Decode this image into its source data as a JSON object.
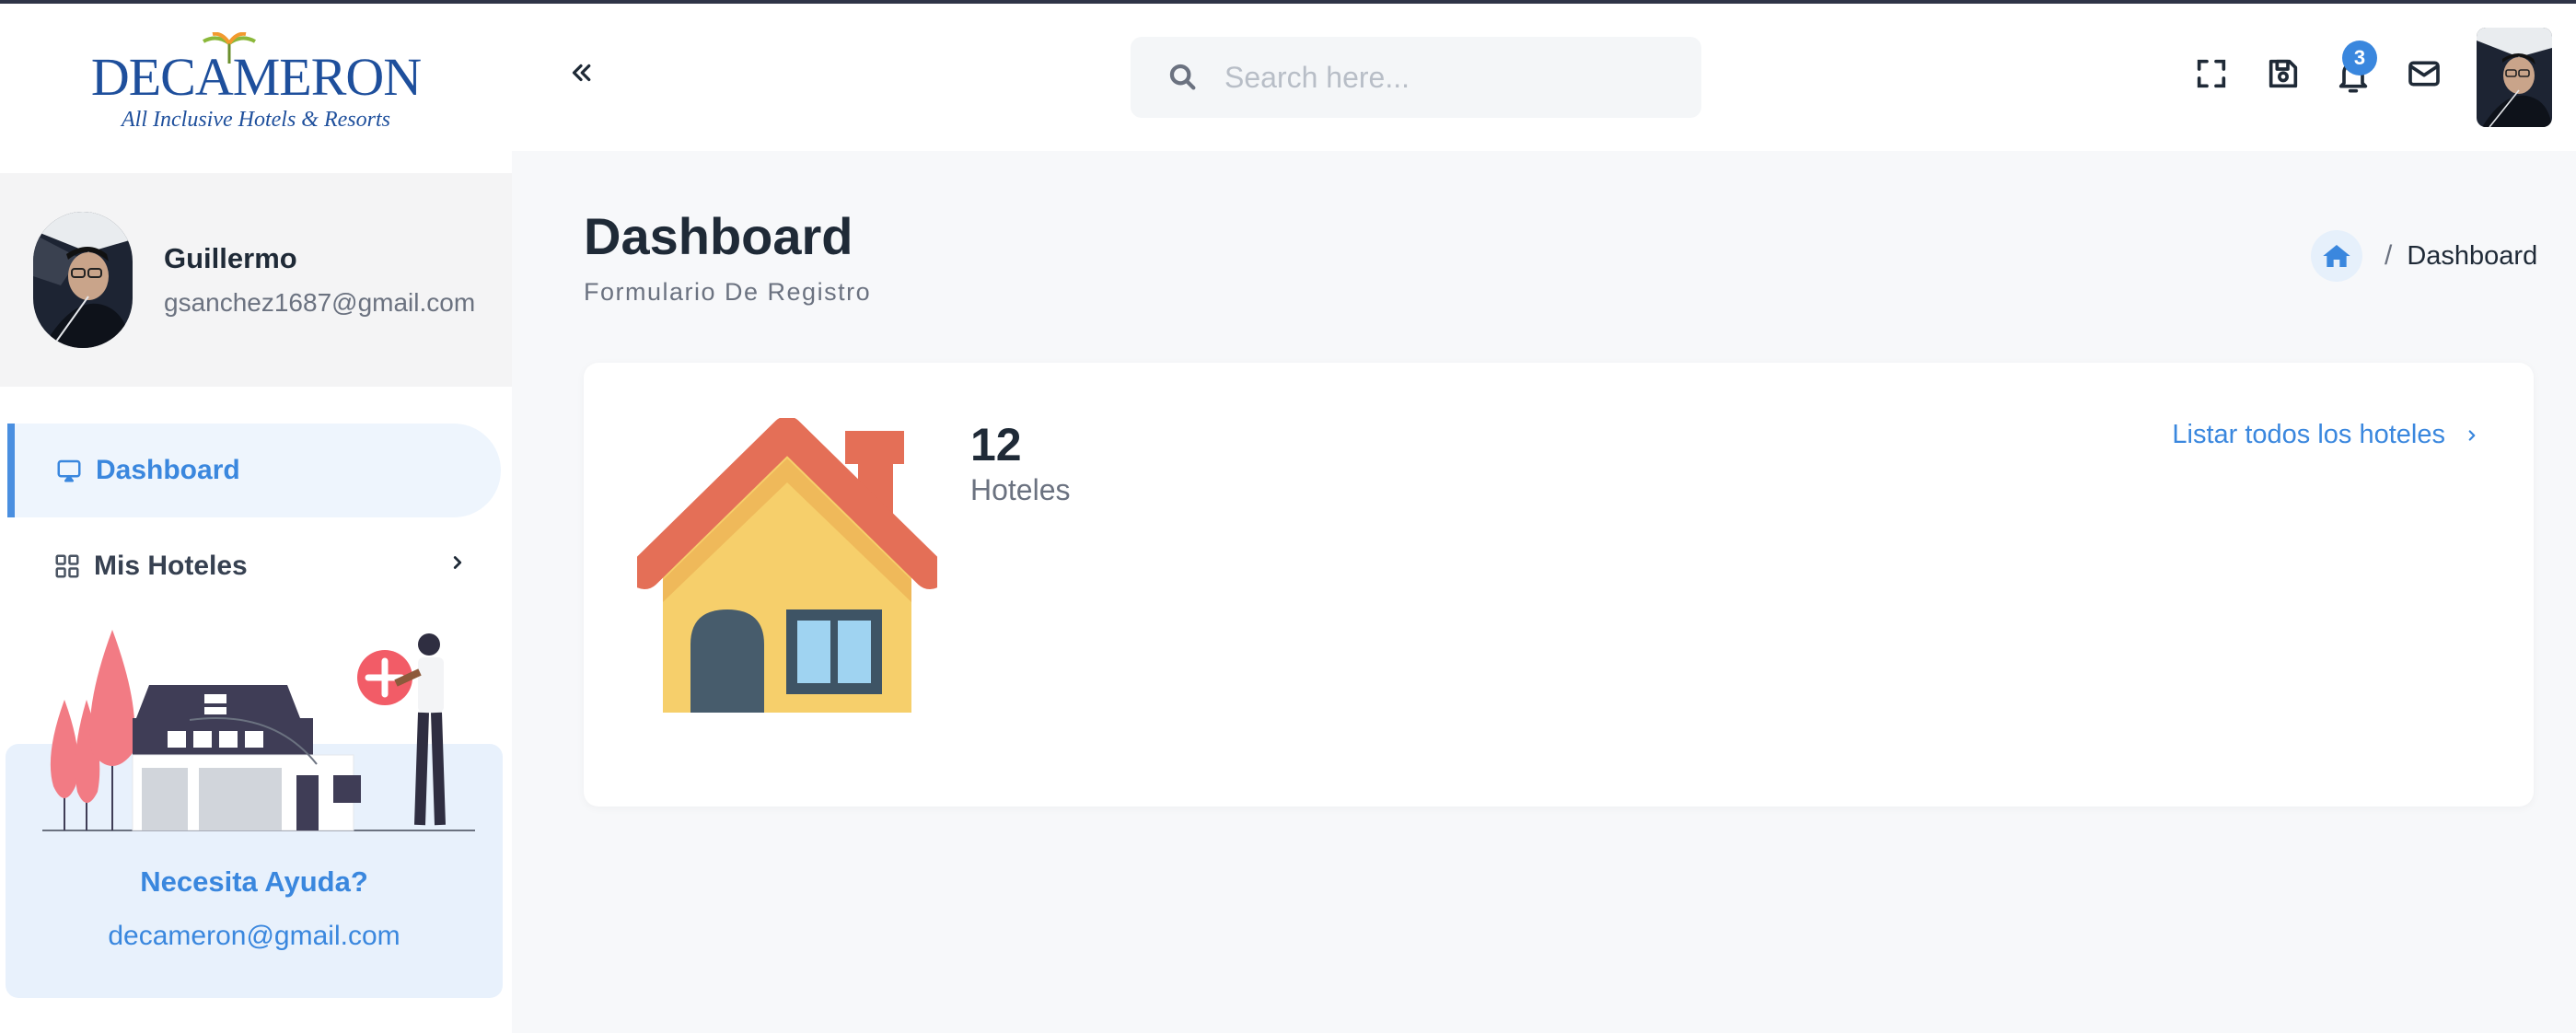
{
  "brand": {
    "logo_word": "DECAMERON",
    "logo_tagline": "All Inclusive Hotels & Resorts"
  },
  "user": {
    "name": "Guillermo",
    "email": "gsanchez1687@gmail.com"
  },
  "sidebar": {
    "items": [
      {
        "label": "Dashboard",
        "icon": "monitor-icon",
        "active": true
      },
      {
        "label": "Mis Hoteles",
        "icon": "grid-icon",
        "active": false,
        "has_submenu": true
      }
    ]
  },
  "help": {
    "title": "Necesita Ayuda?",
    "email": "decameron@gmail.com"
  },
  "header": {
    "search_placeholder": "Search here...",
    "notification_count": "3",
    "icons": [
      "collapse-icon",
      "search-icon",
      "fullscreen-icon",
      "save-icon",
      "bell-icon",
      "mail-icon"
    ]
  },
  "page": {
    "title": "Dashboard",
    "subtitle": "Formulario De Registro"
  },
  "breadcrumb": {
    "current": "Dashboard",
    "separator": "/"
  },
  "stats_card": {
    "count": "12",
    "label": "Hoteles",
    "link_label": "Listar todos los hoteles"
  },
  "colors": {
    "accent": "#3a87de",
    "active_bg": "#eef5fd",
    "help_bg": "#e8f1fc"
  }
}
